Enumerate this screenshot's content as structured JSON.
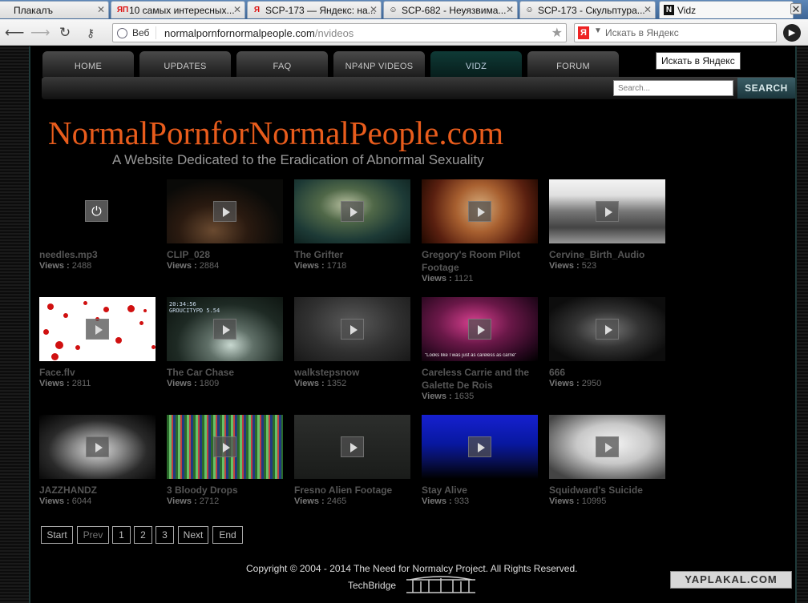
{
  "browser": {
    "tabs": [
      {
        "title": "Плакалъ",
        "favicon": ""
      },
      {
        "title": "10 самых интересных...",
        "favicon": "ЯП"
      },
      {
        "title": "SCP-173 — Яндекс: на...",
        "favicon": "Я"
      },
      {
        "title": "SCP-682 - Неуязвима...",
        "favicon": "☺"
      },
      {
        "title": "SCP-173 - Скульптура...",
        "favicon": "☺"
      },
      {
        "title": "Vidz",
        "favicon": "N"
      }
    ],
    "address": {
      "label": "Веб",
      "host": "normalpornfornormalpeople.com",
      "path": "/nvideos"
    },
    "yandex_search_placeholder": "Искать в Яндекс",
    "yandex_logo": "Я",
    "tooltip": "Искать в Яндекс"
  },
  "site": {
    "nav": [
      "HOME",
      "UPDATES",
      "FAQ",
      "NP4NP VIDEOS",
      "VIDZ",
      "FORUM"
    ],
    "active_nav": "VIDZ",
    "search_placeholder": "Search...",
    "search_button": "SEARCH",
    "title": "NormalPornforNormalPeople.com",
    "tagline": "A Website Dedicated to the Eradication of Abnormal Sexuality",
    "views_label": "Views :",
    "videos": [
      {
        "title": "needles.mp3",
        "views": "2488",
        "thumb": "power"
      },
      {
        "title": "CLIP_028",
        "views": "2884",
        "thumb": "dark-cave"
      },
      {
        "title": "The Grifter",
        "views": "1718",
        "thumb": "green-face"
      },
      {
        "title": "Gregory's Room Pilot Footage",
        "views": "1121",
        "thumb": "orange-face"
      },
      {
        "title": "Cervine_Birth_Audio",
        "views": "523",
        "thumb": "gray-road"
      },
      {
        "title": "Face.flv",
        "views": "2811",
        "thumb": "blood"
      },
      {
        "title": "The Car Chase",
        "views": "1809",
        "thumb": "car-chase"
      },
      {
        "title": "walkstepsnow",
        "views": "1352",
        "thumb": "gray-blur"
      },
      {
        "title": "Careless Carrie and the Galette De Rois",
        "views": "1635",
        "thumb": "anime"
      },
      {
        "title": "666",
        "views": "2950",
        "thumb": "dark-frame"
      },
      {
        "title": "JAZZHANDZ",
        "views": "6044",
        "thumb": "hands"
      },
      {
        "title": "3 Bloody Drops",
        "views": "2712",
        "thumb": "pixel"
      },
      {
        "title": "Fresno Alien Footage",
        "views": "2465",
        "thumb": "dark-gray"
      },
      {
        "title": "Stay Alive",
        "views": "933",
        "thumb": "blue-night"
      },
      {
        "title": "Squidward's Suicide",
        "views": "10995",
        "thumb": "squid"
      }
    ],
    "pagination": [
      "Start",
      "Prev",
      "1",
      "2",
      "3",
      "Next",
      "End"
    ],
    "thumb_texts": {
      "car": "20:34:56 GROUCITYPD 5.54",
      "anime": "\"Looks like I was just as careless as carrie\""
    },
    "footer_copyright": "Copyright © 2004 - 2014 The Need for Normalcy Project. All Rights Reserved.",
    "footer_credit": "TechBridge"
  },
  "watermark": "YAPLAKAL.COM"
}
